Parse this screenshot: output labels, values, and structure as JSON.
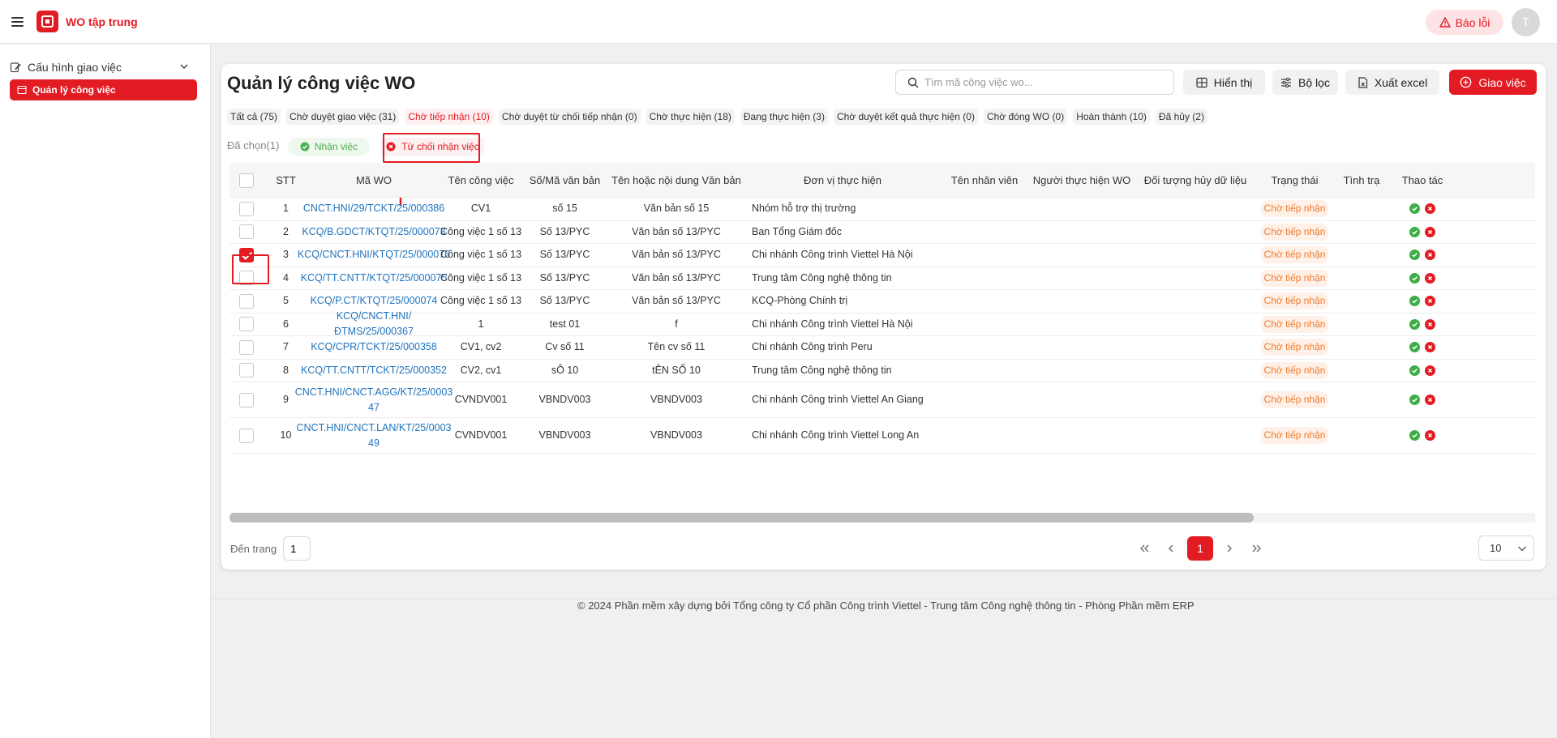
{
  "header": {
    "app_title": "WO tập trung",
    "report_label": "Báo lỗi",
    "avatar_letter": "T"
  },
  "sidebar": {
    "group_label": "Cấu hình giao việc",
    "active_label": "Quản lý công việc"
  },
  "page": {
    "title": "Quản lý công việc WO"
  },
  "search": {
    "placeholder": "Tìm mã công việc wo..."
  },
  "toolbar": {
    "display_label": "Hiển thị",
    "filter_label": "Bộ lọc",
    "export_label": "Xuất excel",
    "assign_label": "Giao việc"
  },
  "tabs": [
    "Tất cả (75)",
    "Chờ duyệt giao việc (31)",
    "Chờ tiếp nhận (10)",
    "Chờ duyệt từ chối tiếp nhận (0)",
    "Chờ thực hiện (18)",
    "Đang thực hiện (3)",
    "Chờ duyệt kết quả thực hiện (0)",
    "Chờ đóng WO (0)",
    "Hoàn thành (10)",
    "Đã hủy (2)"
  ],
  "active_tab": "Chờ tiếp nhận (10)",
  "selection": {
    "label": "Đã chọn(1)",
    "accept_label": "Nhận việc",
    "reject_label": "Từ chối nhận việc"
  },
  "table": {
    "columns": [
      "STT",
      "Mã WO",
      "Tên công việc",
      "Số/Mã văn bản",
      "Tên hoặc nội dung Văn bản",
      "Đơn vị thực hiện",
      "Tên nhân viên",
      "Người thực hiện WO",
      "Đối tượng hủy dữ liệu",
      "Trạng thái",
      "Tình trạ",
      "Thao tác"
    ],
    "rows": [
      {
        "stt": "1",
        "code": "CNCT.HNI/29/TCKT/25/000386",
        "name": "CV1",
        "doc_no": "số 15",
        "doc_name": "Văn bản số 15",
        "unit": "Nhóm hỗ trợ thị trường",
        "status": "Chờ tiếp nhận",
        "checked": false
      },
      {
        "stt": "2",
        "code": "KCQ/B.GDCT/KTQT/25/000073",
        "name": "Công việc 1 số 13",
        "doc_no": "Số 13/PYC",
        "doc_name": "Văn bản số 13/PYC",
        "unit": "Ban Tổng Giám đốc",
        "status": "Chờ tiếp nhận",
        "checked": false
      },
      {
        "stt": "3",
        "code": "KCQ/CNCT.HNI/KTQT/25/000076",
        "name": "Công việc 1 số 13",
        "doc_no": "Số 13/PYC",
        "doc_name": "Văn bản số 13/PYC",
        "unit": "Chi nhánh Công trình Viettel Hà Nội",
        "status": "Chờ tiếp nhận",
        "checked": true
      },
      {
        "stt": "4",
        "code": "KCQ/TT.CNTT/KTQT/25/000075",
        "name": "Công việc 1 số 13",
        "doc_no": "Số 13/PYC",
        "doc_name": "Văn bản số 13/PYC",
        "unit": "Trung tâm Công nghệ thông tin",
        "status": "Chờ tiếp nhận",
        "checked": false
      },
      {
        "stt": "5",
        "code": "KCQ/P.CT/KTQT/25/000074",
        "name": "Công việc 1 số 13",
        "doc_no": "Số 13/PYC",
        "doc_name": "Văn bản số 13/PYC",
        "unit": "KCQ-Phòng Chính trị",
        "status": "Chờ tiếp nhận",
        "checked": false
      },
      {
        "stt": "6",
        "code": "KCQ/CNCT.HNI/ĐTMS/25/000367",
        "name": "1",
        "doc_no": "test 01",
        "doc_name": "f",
        "unit": "Chi nhánh Công trình Viettel Hà Nội",
        "status": "Chờ tiếp nhận",
        "checked": false
      },
      {
        "stt": "7",
        "code": "KCQ/CPR/TCKT/25/000358",
        "name": "CV1, cv2",
        "doc_no": "Cv số 11",
        "doc_name": "Tên cv số 11",
        "unit": "Chi nhánh Công trình Peru",
        "status": "Chờ tiếp nhận",
        "checked": false
      },
      {
        "stt": "8",
        "code": "KCQ/TT.CNTT/TCKT/25/000352",
        "name": "CV2, cv1",
        "doc_no": "sÔ 10",
        "doc_name": "tÊN SỐ 10",
        "unit": "Trung tâm Công nghệ thông tin",
        "status": "Chờ tiếp nhận",
        "checked": false
      },
      {
        "stt": "9",
        "code": "CNCT.HNI/CNCT.AGG/KT/25/000347",
        "code_l1": "CNCT.HNI/CNCT.AGG/KT/25/0003",
        "code_l2": "47",
        "name": "CVNDV001",
        "doc_no": "VBNDV003",
        "doc_name": "VBNDV003",
        "unit": "Chi nhánh Công trình Viettel An Giang",
        "status": "Chờ tiếp nhận",
        "checked": false
      },
      {
        "stt": "10",
        "code": "CNCT.HNI/CNCT.LAN/KT/25/000349",
        "code_l1": "CNCT.HNI/CNCT.LAN/KT/25/0003",
        "code_l2": "49",
        "name": "CVNDV001",
        "doc_no": "VBNDV003",
        "doc_name": "VBNDV003",
        "unit": "Chi nhánh Công trình Viettel Long An",
        "status": "Chờ tiếp nhận",
        "checked": false
      }
    ]
  },
  "pagination": {
    "goto_label": "Đến trang",
    "goto_value": "1",
    "current_page": "1",
    "page_size": "10"
  },
  "footer": {
    "text": "© 2024 Phần mềm xây dựng bởi Tổng công ty Cổ phần Công trình Viettel - Trung tâm Công nghệ thông tin - Phòng Phần mềm ERP"
  },
  "colors": {
    "brand": "#e31b23",
    "link": "#1e73be",
    "status_text": "#f07a2b",
    "accept": "#3cae45"
  },
  "icons": [
    "menu-icon",
    "logo-icon",
    "warning-icon",
    "edit-icon",
    "chevron-down-icon",
    "list-icon",
    "search-icon",
    "grid-icon",
    "filter-icon",
    "excel-icon",
    "plus-circle-icon",
    "check-circle-icon",
    "x-circle-icon",
    "arrow-up-icon",
    "first-page-icon",
    "prev-page-icon",
    "next-page-icon",
    "last-page-icon"
  ]
}
